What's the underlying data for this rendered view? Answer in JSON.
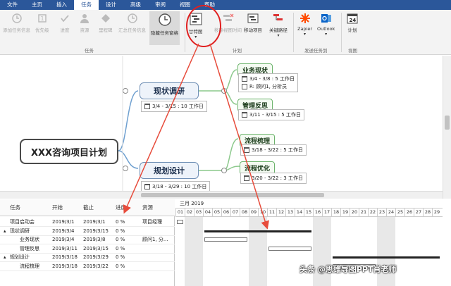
{
  "tabs": [
    "文件",
    "主页",
    "插入",
    "任务",
    "设计",
    "高级",
    "审阅",
    "视图",
    "帮助"
  ],
  "ribbon": {
    "buttons": [
      {
        "label": "添加任务信息",
        "name": "add-task-info-button"
      },
      {
        "label": "优先级",
        "name": "priority-button"
      },
      {
        "label": "进度",
        "name": "progress-button"
      },
      {
        "label": "资源",
        "name": "resource-button"
      },
      {
        "label": "里程碑",
        "name": "milestone-button"
      },
      {
        "label": "汇总任务信息",
        "name": "summary-task-info-button"
      },
      {
        "label": "隐藏任务窗格",
        "name": "hide-task-pane-button"
      },
      {
        "label": "甘特图",
        "name": "gantt-chart-button"
      },
      {
        "label": "移除视图时间",
        "name": "remove-view-time-button"
      },
      {
        "label": "移动项目",
        "name": "move-project-button"
      },
      {
        "label": "关键路径",
        "name": "critical-path-button"
      },
      {
        "label": "Zapier",
        "name": "zapier-button"
      },
      {
        "label": "Outlook",
        "name": "outlook-button"
      },
      {
        "label": "计划",
        "name": "schedule-button"
      }
    ],
    "groups": [
      "任务",
      "计划",
      "发送任务到",
      "视图"
    ]
  },
  "mindmap": {
    "root": "XXX咨询项目计划",
    "topics": [
      {
        "title": "现状调研",
        "date": "3/4 - 3/15 : 10 工作日"
      },
      {
        "title": "规划设计",
        "date": "3/18 - 3/29 : 10 工作日"
      }
    ],
    "leaves": [
      {
        "title": "业务现状",
        "date": "3/4 - 3/8 : 5 工作日",
        "resource": "R: 顾问1, 分析员"
      },
      {
        "title": "管理反思",
        "date": "3/11 - 3/15 : 5 工作日"
      },
      {
        "title": "流程梳理",
        "date": "3/18 - 3/22 : 5 工作日"
      },
      {
        "title": "流程优化",
        "date": "3/20 - 3/22 : 3 工作日"
      }
    ]
  },
  "grid": {
    "headers": [
      "任务",
      "开始",
      "截止",
      "进度",
      "资源"
    ],
    "rows": [
      {
        "task": "项目启动会",
        "start": "2019/3/1",
        "end": "2019/3/1",
        "progress": "0 %",
        "resource": "项目经理",
        "indent": 0
      },
      {
        "task": "现状调研",
        "start": "2019/3/4",
        "end": "2019/3/15",
        "progress": "0 %",
        "resource": "",
        "indent": 0
      },
      {
        "task": "业务现状",
        "start": "2019/3/4",
        "end": "2019/3/8",
        "progress": "0 %",
        "resource": "顾问1, 分...",
        "indent": 1
      },
      {
        "task": "管理反思",
        "start": "2019/3/11",
        "end": "2019/3/15",
        "progress": "0 %",
        "resource": "",
        "indent": 1
      },
      {
        "task": "规划设计",
        "start": "2019/3/18",
        "end": "2019/3/29",
        "progress": "0 %",
        "resource": "",
        "indent": 0
      },
      {
        "task": "流程梳理",
        "start": "2019/3/18",
        "end": "2019/3/22",
        "progress": "0 %",
        "resource": "",
        "indent": 1
      }
    ]
  },
  "gantt": {
    "month": "三月 2019",
    "days": [
      "01",
      "02",
      "03",
      "04",
      "05",
      "06",
      "07",
      "08",
      "09",
      "10",
      "11",
      "12",
      "13",
      "14",
      "15",
      "16",
      "17",
      "18",
      "19",
      "20",
      "21",
      "22",
      "23",
      "24",
      "25",
      "26",
      "27",
      "28",
      "29"
    ],
    "weekend_days": [
      2,
      3,
      9,
      10,
      16,
      17,
      23,
      24
    ],
    "bars": [
      {
        "start": 1,
        "end": 1,
        "summary": false
      },
      {
        "start": 4,
        "end": 15,
        "summary": true
      },
      {
        "start": 4,
        "end": 8,
        "summary": false
      },
      {
        "start": 11,
        "end": 15,
        "summary": false
      },
      {
        "start": 18,
        "end": 29,
        "summary": true
      },
      {
        "start": 18,
        "end": 22,
        "summary": false
      }
    ]
  },
  "watermark": "头条 @思维导图PPT肖老师",
  "colors": {
    "tab_bar": "#2b579a",
    "highlight_circle": "#e02020",
    "arrow": "#e74c3c"
  }
}
